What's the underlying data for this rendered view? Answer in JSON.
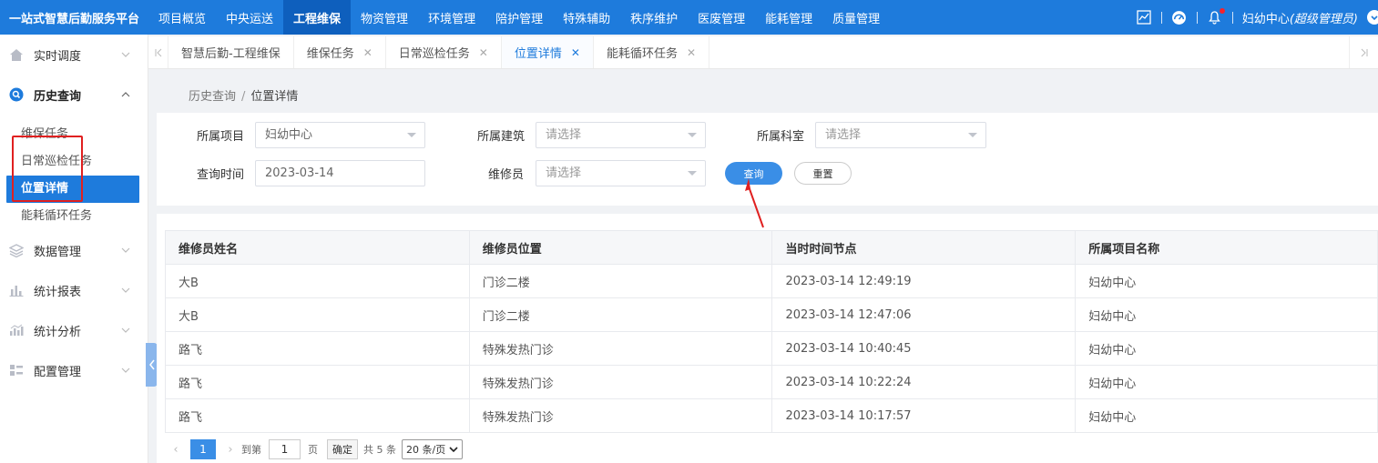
{
  "header": {
    "brand": "一站式智慧后勤服务平台",
    "nav": [
      {
        "label": "项目概览",
        "active": false
      },
      {
        "label": "中央运送",
        "active": false
      },
      {
        "label": "工程维保",
        "active": true
      },
      {
        "label": "物资管理",
        "active": false
      },
      {
        "label": "环境管理",
        "active": false
      },
      {
        "label": "陪护管理",
        "active": false
      },
      {
        "label": "特殊辅助",
        "active": false
      },
      {
        "label": "秩序维护",
        "active": false
      },
      {
        "label": "医废管理",
        "active": false
      },
      {
        "label": "能耗管理",
        "active": false
      },
      {
        "label": "质量管理",
        "active": false
      }
    ],
    "user_name": "妇幼中心",
    "user_role": "(超级管理员)",
    "icons": [
      "chart-icon",
      "dashboard-icon",
      "bell-icon",
      "user-dropdown-icon"
    ]
  },
  "sidebar": {
    "groups": [
      {
        "label": "实时调度",
        "icon": "home-icon"
      },
      {
        "label": "历史查询",
        "icon": "search-icon"
      },
      {
        "label": "数据管理",
        "icon": "layers-icon"
      },
      {
        "label": "统计报表",
        "icon": "bar-chart-icon"
      },
      {
        "label": "统计分析",
        "icon": "analysis-icon"
      },
      {
        "label": "配置管理",
        "icon": "config-icon"
      }
    ],
    "history_items": [
      "维保任务",
      "日常巡检任务",
      "位置详情",
      "能耗循环任务"
    ],
    "active_item": "位置详情"
  },
  "tabs": [
    {
      "label": "智慧后勤-工程维保",
      "closable": false
    },
    {
      "label": "维保任务",
      "closable": true
    },
    {
      "label": "日常巡检任务",
      "closable": true
    },
    {
      "label": "位置详情",
      "closable": true,
      "active": true
    },
    {
      "label": "能耗循环任务",
      "closable": true
    }
  ],
  "breadcrumb": {
    "parent": "历史查询",
    "sep": "/",
    "current": "位置详情"
  },
  "filters": {
    "project_label": "所属项目",
    "project_value": "妇幼中心",
    "building_label": "所属建筑",
    "building_placeholder": "请选择",
    "department_label": "所属科室",
    "department_placeholder": "请选择",
    "time_label": "查询时间",
    "time_value": "2023-03-14",
    "worker_label": "维修员",
    "worker_placeholder": "请选择",
    "query_button": "查询",
    "reset_button": "重置"
  },
  "table": {
    "columns": [
      "维修员姓名",
      "维修员位置",
      "当时时间节点",
      "所属项目名称"
    ],
    "rows": [
      [
        "大B",
        "门诊二楼",
        "2023-03-14 12:49:19",
        "妇幼中心"
      ],
      [
        "大B",
        "门诊二楼",
        "2023-03-14 12:47:06",
        "妇幼中心"
      ],
      [
        "路飞",
        "特殊发热门诊",
        "2023-03-14 10:40:45",
        "妇幼中心"
      ],
      [
        "路飞",
        "特殊发热门诊",
        "2023-03-14 10:22:24",
        "妇幼中心"
      ],
      [
        "路飞",
        "特殊发热门诊",
        "2023-03-14 10:17:57",
        "妇幼中心"
      ]
    ]
  },
  "pagination": {
    "current_page": "1",
    "goto_prefix": "到第",
    "goto_value": "1",
    "goto_suffix": "页",
    "confirm": "确定",
    "total": "共 5 条",
    "page_size": "20 条/页"
  },
  "colors": {
    "primary": "#1e7bdc",
    "highlight_box": "#e02020",
    "arrow": "#e02020"
  }
}
